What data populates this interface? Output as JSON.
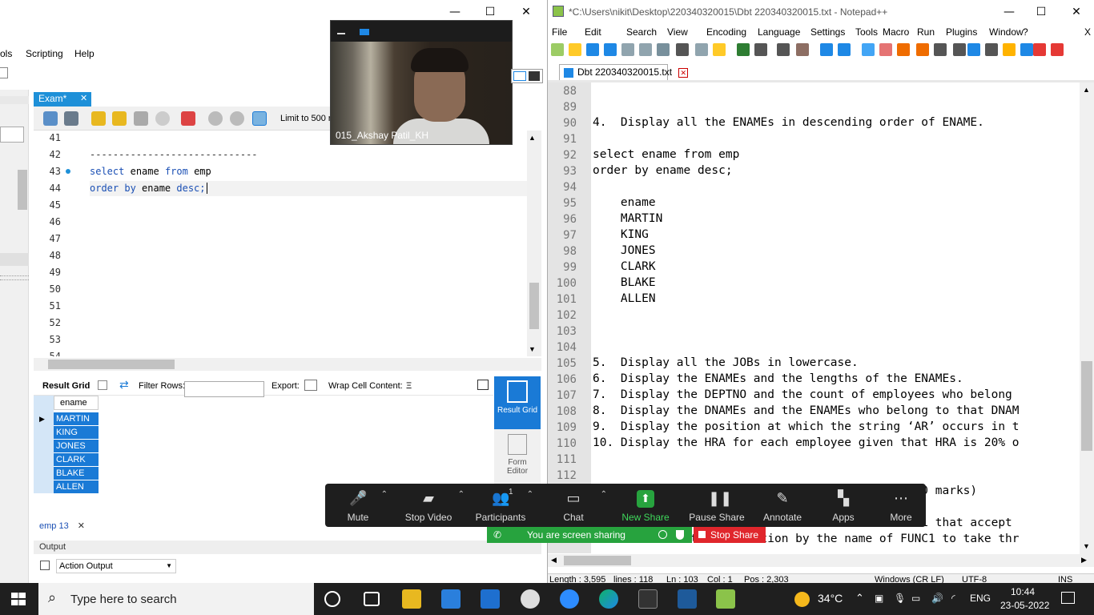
{
  "workbench": {
    "menu": [
      "ols",
      "Scripting",
      "Help"
    ],
    "sql_tab": "Exam*",
    "limit_label": "Limit to 500 ro",
    "code_lines": [
      {
        "num": "41",
        "text": ""
      },
      {
        "num": "42",
        "text": "-----------------------------"
      },
      {
        "num": "43",
        "text": "select ename from emp"
      },
      {
        "num": "44",
        "text": "order by ename desc;"
      },
      {
        "num": "45",
        "text": ""
      },
      {
        "num": "46",
        "text": ""
      },
      {
        "num": "47",
        "text": ""
      },
      {
        "num": "48",
        "text": ""
      },
      {
        "num": "49",
        "text": ""
      },
      {
        "num": "50",
        "text": ""
      },
      {
        "num": "51",
        "text": ""
      },
      {
        "num": "52",
        "text": ""
      },
      {
        "num": "53",
        "text": ""
      },
      {
        "num": "54",
        "text": ""
      }
    ],
    "result_bar": {
      "result_grid": "Result Grid",
      "filter_rows": "Filter Rows:",
      "export": "Export:",
      "wrap": "Wrap Cell Content:"
    },
    "grid_header": "ename",
    "grid_rows": [
      "MARTIN",
      "KING",
      "JONES",
      "CLARK",
      "BLAKE",
      "ALLEN"
    ],
    "side_buttons": {
      "result_grid": "Result Grid",
      "form_editor": "Form Editor"
    },
    "result_tab": "emp 13",
    "output_label": "Output",
    "action_output": "Action Output"
  },
  "zoom_video": {
    "name": "015_Akshay Patil_KH"
  },
  "notepad": {
    "title": "*C:\\Users\\nikit\\Desktop\\220340320015\\Dbt 220340320015.txt - Notepad++",
    "menu": [
      "File",
      "Edit",
      "Search",
      "View",
      "Encoding",
      "Language",
      "Settings",
      "Tools",
      "Macro",
      "Run",
      "Plugins",
      "Window",
      "?"
    ],
    "close_x": "X",
    "tab": "Dbt 220340320015.txt",
    "lines": [
      {
        "num": "88",
        "text": ""
      },
      {
        "num": "89",
        "text": ""
      },
      {
        "num": "90",
        "text": "4.  Display all the ENAMEs in descending order of ENAME."
      },
      {
        "num": "91",
        "text": ""
      },
      {
        "num": "92",
        "text": "select ename from emp"
      },
      {
        "num": "93",
        "text": "order by ename desc;"
      },
      {
        "num": "94",
        "text": ""
      },
      {
        "num": "95",
        "text": "    ename"
      },
      {
        "num": "96",
        "text": "    MARTIN"
      },
      {
        "num": "97",
        "text": "    KING"
      },
      {
        "num": "98",
        "text": "    JONES"
      },
      {
        "num": "99",
        "text": "    CLARK"
      },
      {
        "num": "100",
        "text": "    BLAKE"
      },
      {
        "num": "101",
        "text": "    ALLEN"
      },
      {
        "num": "102",
        "text": ""
      },
      {
        "num": "103",
        "text": ""
      },
      {
        "num": "104",
        "text": ""
      },
      {
        "num": "105",
        "text": "5.  Display all the JOBs in lowercase."
      },
      {
        "num": "106",
        "text": "6.  Display the ENAMEs and the lengths of the ENAMEs."
      },
      {
        "num": "107",
        "text": "7.  Display the DEPTNO and the count of employees who belong"
      },
      {
        "num": "108",
        "text": "8.  Display the DNAMEs and the ENAMEs who belong to that DNAM"
      },
      {
        "num": "109",
        "text": "9.  Display the position at which the string ‘AR’ occurs in t"
      },
      {
        "num": "110",
        "text": "10. Display the HRA for each employee given that HRA is 20% o"
      },
      {
        "num": "111",
        "text": ""
      },
      {
        "num": "112",
        "text": ""
      },
      {
        "num": "",
        "text": "                                             (10 marks)"
      },
      {
        "num": "",
        "text": ""
      },
      {
        "num": "",
        "text": "                                        of PROC1 that accept"
      },
      {
        "num": "117",
        "text": "2.  Create a stored function by the name of FUNC1 to take thr"
      }
    ],
    "status": {
      "length": "Length : 3,595",
      "lines": "lines : 118",
      "ln": "Ln : 103",
      "col": "Col : 1",
      "pos": "Pos : 2,303",
      "eol": "Windows (CR LF)",
      "encoding": "UTF-8",
      "ins": "INS"
    }
  },
  "zoom_bar": {
    "buttons": [
      {
        "label": "Mute",
        "icon": "mic-icon"
      },
      {
        "label": "Stop Video",
        "icon": "video-icon"
      },
      {
        "label": "Participants",
        "icon": "participants-icon",
        "count": "1"
      },
      {
        "label": "Chat",
        "icon": "chat-icon"
      },
      {
        "label": "New Share",
        "icon": "share-icon"
      },
      {
        "label": "Pause Share",
        "icon": "pause-icon"
      },
      {
        "label": "Annotate",
        "icon": "pen-icon"
      },
      {
        "label": "Apps",
        "icon": "apps-icon"
      },
      {
        "label": "More",
        "icon": "more-icon"
      }
    ],
    "sharing_text": "You are screen sharing",
    "stop_share": "Stop Share"
  },
  "taskbar": {
    "search_placeholder": "Type here to search",
    "temperature": "34°C",
    "language": "ENG",
    "time": "10:44",
    "date": "23-05-2022"
  },
  "colors": {
    "accent_blue": "#1a7ad6",
    "zoom_green": "#27a33e",
    "zoom_red": "#e0262c",
    "taskbar": "#1f1f1f"
  }
}
